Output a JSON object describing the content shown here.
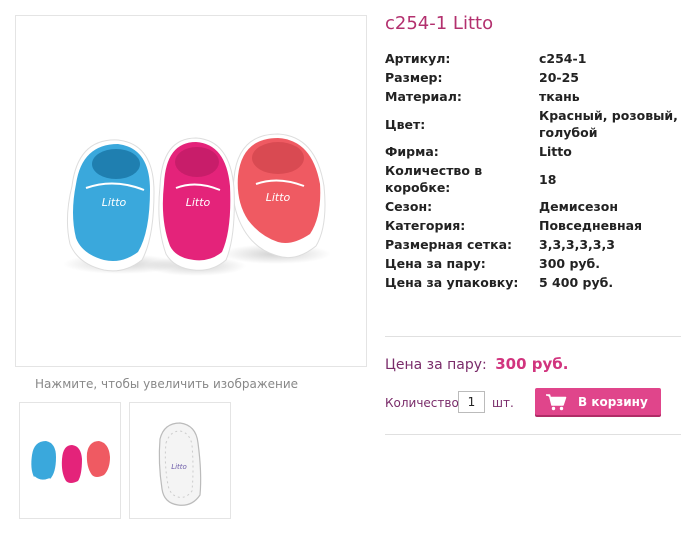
{
  "product": {
    "title": "c254-1 Litto"
  },
  "gallery": {
    "zoom_hint": "Нажмите, чтобы увеличить изображение"
  },
  "specs": [
    {
      "key": "Артикул:",
      "value": "c254-1"
    },
    {
      "key": "Размер:",
      "value": "20-25"
    },
    {
      "key": "Материал:",
      "value": "ткань"
    },
    {
      "key": "Цвет:",
      "value": "Красный, розовый, голубой"
    },
    {
      "key": "Фирма:",
      "value": "Litto"
    },
    {
      "key": "Количество в коробке:",
      "value": "18"
    },
    {
      "key": "Сезон:",
      "value": "Демисезон"
    },
    {
      "key": "Категория:",
      "value": "Повседневная"
    },
    {
      "key": "Размерная сетка:",
      "value": "3,3,3,3,3,3"
    },
    {
      "key": "Цена за пару:",
      "value": "300 руб."
    },
    {
      "key": "Цена за упаковку:",
      "value": "5 400 руб."
    }
  ],
  "purchase": {
    "price_label": "Цена за пару:",
    "price_value": "300 руб.",
    "quantity_label": "Количество",
    "quantity_value": "1",
    "unit": "шт.",
    "cart_button": "В корзину",
    "cart_icon": "shopping-cart-icon"
  },
  "colors": {
    "accent": "#e0458b",
    "title": "#b3306e",
    "price": "#d1347e",
    "shoe_blue": "#3aa8dc",
    "shoe_pink": "#e4237a",
    "shoe_red": "#ef5a62"
  }
}
